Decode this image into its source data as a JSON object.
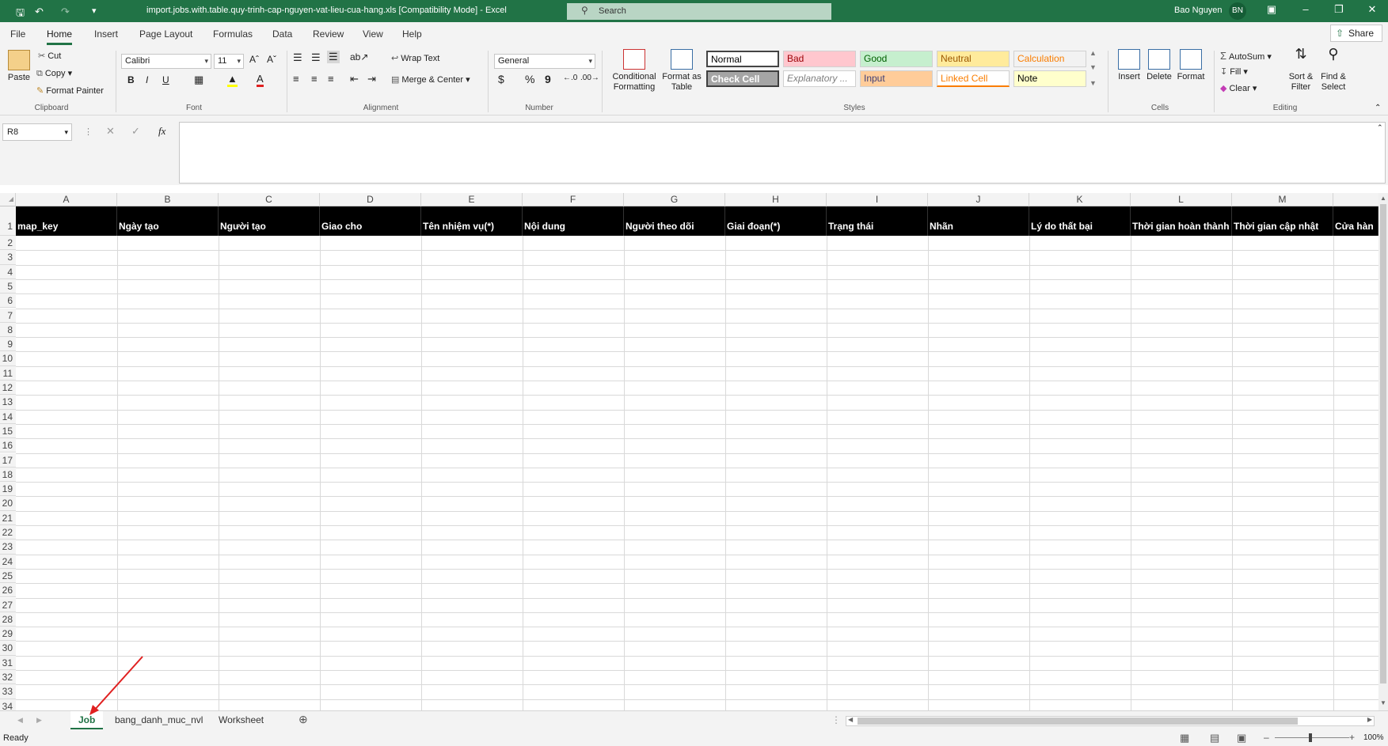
{
  "titlebar": {
    "filename": "import.jobs.with.table.quy-trinh-cap-nguyen-vat-lieu-cua-hang.xls  [Compatibility Mode]  -  Excel",
    "search_placeholder": "Search",
    "user_name": "Bao Nguyen",
    "user_initials": "BN"
  },
  "menu": {
    "tabs": [
      "File",
      "Home",
      "Insert",
      "Page Layout",
      "Formulas",
      "Data",
      "Review",
      "View",
      "Help"
    ],
    "active": "Home",
    "share_label": "Share"
  },
  "ribbon": {
    "clipboard": {
      "paste": "Paste",
      "cut": "Cut",
      "copy": "Copy",
      "format_painter": "Format Painter",
      "label": "Clipboard"
    },
    "font": {
      "name": "Calibri",
      "size": "11",
      "bold": "B",
      "italic": "I",
      "underline": "U",
      "label": "Font"
    },
    "alignment": {
      "wrap_text": "Wrap Text",
      "merge_center": "Merge & Center",
      "label": "Alignment"
    },
    "number": {
      "format": "General",
      "currency": "$",
      "percent": "%",
      "comma": "9",
      "label": "Number"
    },
    "styles": {
      "conditional_formatting": "Conditional Formatting",
      "format_as_table": "Format as Table",
      "cells": [
        {
          "label": "Normal",
          "bg": "#ffffff",
          "color": "#000000"
        },
        {
          "label": "Bad",
          "bg": "#ffc7ce",
          "color": "#9c0006"
        },
        {
          "label": "Good",
          "bg": "#c6efce",
          "color": "#006100"
        },
        {
          "label": "Neutral",
          "bg": "#ffeb9c",
          "color": "#9c5700"
        },
        {
          "label": "Calculation",
          "bg": "#f2f2f2",
          "color": "#fa7d00"
        },
        {
          "label": "Check Cell",
          "bg": "#a5a5a5",
          "color": "#ffffff"
        },
        {
          "label": "Explanatory ...",
          "bg": "#ffffff",
          "color": "#7f7f7f"
        },
        {
          "label": "Input",
          "bg": "#ffcc99",
          "color": "#3f3f76"
        },
        {
          "label": "Linked Cell",
          "bg": "#ffffff",
          "color": "#fa7d00"
        },
        {
          "label": "Note",
          "bg": "#ffffcc",
          "color": "#000000"
        }
      ],
      "label": "Styles"
    },
    "cells_group": {
      "insert": "Insert",
      "delete": "Delete",
      "format": "Format",
      "label": "Cells"
    },
    "editing": {
      "autosum": "AutoSum",
      "fill": "Fill",
      "clear": "Clear",
      "sort_filter": "Sort & Filter",
      "find_select": "Find & Select",
      "label": "Editing"
    }
  },
  "formula_bar": {
    "name_box": "R8",
    "fx": "fx",
    "value": ""
  },
  "sheet": {
    "columns": [
      "A",
      "B",
      "C",
      "D",
      "E",
      "F",
      "G",
      "H",
      "I",
      "J",
      "K",
      "L",
      "M"
    ],
    "headers": [
      "map_key",
      "Ngày tạo",
      "Người tạo",
      "Giao cho",
      "Tên nhiệm vụ(*)",
      "Nội dung",
      "Người theo dõi",
      "Giai đoạn(*)",
      "Trạng thái",
      "Nhãn",
      "Lý do thất bại",
      "Thời gian hoàn thành",
      "Thời gian cập nhật",
      "Cửa hàn"
    ],
    "rows": [
      "1",
      "2",
      "3",
      "4",
      "5",
      "6",
      "7",
      "8",
      "9",
      "10",
      "11",
      "12",
      "13",
      "14",
      "15",
      "16",
      "17",
      "18",
      "19",
      "20",
      "21",
      "22",
      "23",
      "24",
      "25",
      "26",
      "27",
      "28",
      "29",
      "30",
      "31",
      "32",
      "33",
      "34"
    ]
  },
  "sheet_tabs": {
    "tabs": [
      "Job",
      "bang_danh_muc_nvl",
      "Worksheet"
    ],
    "active": "Job"
  },
  "status": {
    "text": "Ready",
    "zoom": "100%"
  },
  "colors": {
    "excel_green": "#217346",
    "header_bg": "#000000"
  }
}
